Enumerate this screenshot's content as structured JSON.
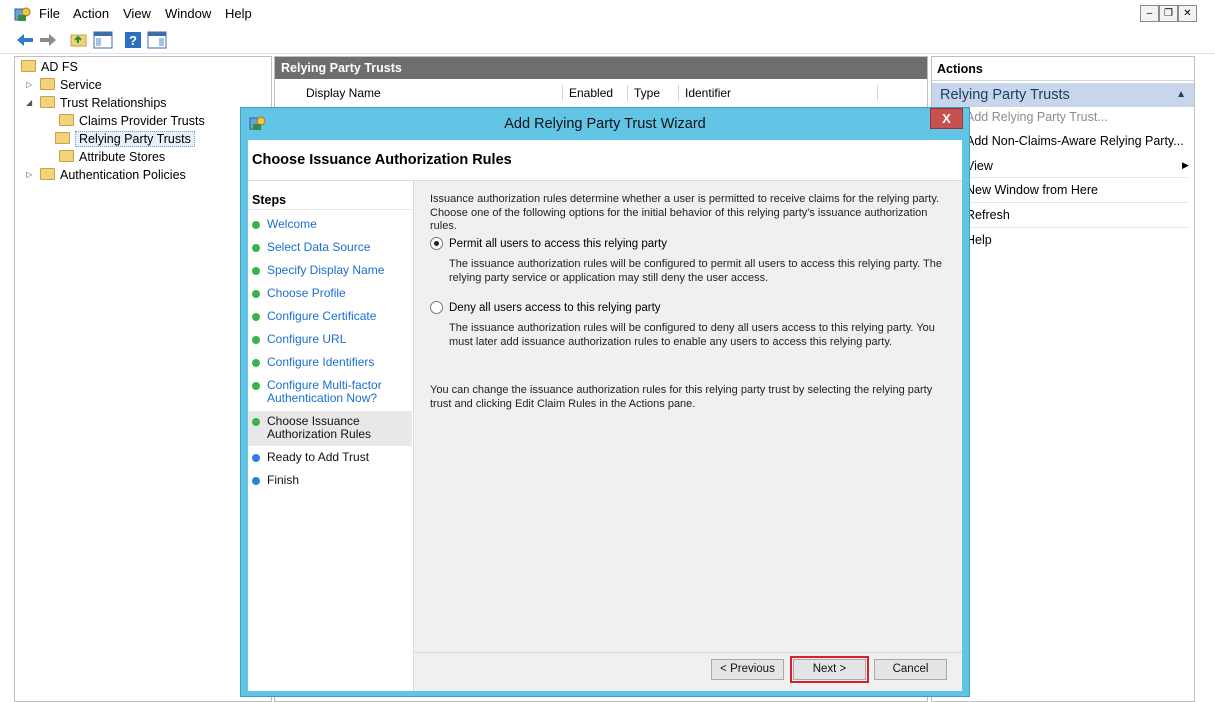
{
  "menubar": {
    "items": [
      "File",
      "Action",
      "View",
      "Window",
      "Help"
    ]
  },
  "tree": {
    "items": [
      {
        "label": "AD FS"
      },
      {
        "label": "Service"
      },
      {
        "label": "Trust Relationships"
      },
      {
        "label": "Claims Provider Trusts"
      },
      {
        "label": "Relying Party Trusts"
      },
      {
        "label": "Attribute Stores"
      },
      {
        "label": "Authentication Policies"
      }
    ]
  },
  "center": {
    "title": "Relying Party Trusts",
    "columns": [
      "Display Name",
      "Enabled",
      "Type",
      "Identifier"
    ]
  },
  "actions": {
    "title": "Actions",
    "section": "Relying Party Trusts",
    "items": [
      "Add Relying Party Trust...",
      "Add Non-Claims-Aware Relying Party...",
      "View",
      "New Window from Here",
      "Refresh",
      "Help"
    ]
  },
  "wizard": {
    "title": "Add Relying Party Trust Wizard",
    "close_label": "X",
    "heading": "Choose Issuance Authorization Rules",
    "steps_title": "Steps",
    "steps": [
      "Welcome",
      "Select Data Source",
      "Specify Display Name",
      "Choose Profile",
      "Configure Certificate",
      "Configure URL",
      "Configure Identifiers",
      "Configure Multi-factor Authentication Now?",
      "Choose Issuance Authorization Rules",
      "Ready to Add Trust",
      "Finish"
    ],
    "intro": "Issuance authorization rules determine whether a user is permitted to receive claims for the relying party. Choose one of the following options for the initial behavior of this relying party's issuance authorization rules.",
    "option_permit": {
      "label": "Permit all users to access this relying party",
      "description": "The issuance authorization rules will be configured to permit all users to access this relying party. The relying party service or application may still deny the user access.",
      "checked": true
    },
    "option_deny": {
      "label": "Deny all users access to this relying party",
      "description": "The issuance authorization rules will be configured to deny all users access to this relying party. You must later add issuance authorization rules to enable any users to access this relying party.",
      "checked": false
    },
    "footer_note": "You can change the issuance authorization rules for this relying party trust by selecting the relying party trust and clicking Edit Claim Rules in the Actions pane.",
    "buttons": {
      "previous": "< Previous",
      "next": "Next >",
      "cancel": "Cancel"
    }
  }
}
